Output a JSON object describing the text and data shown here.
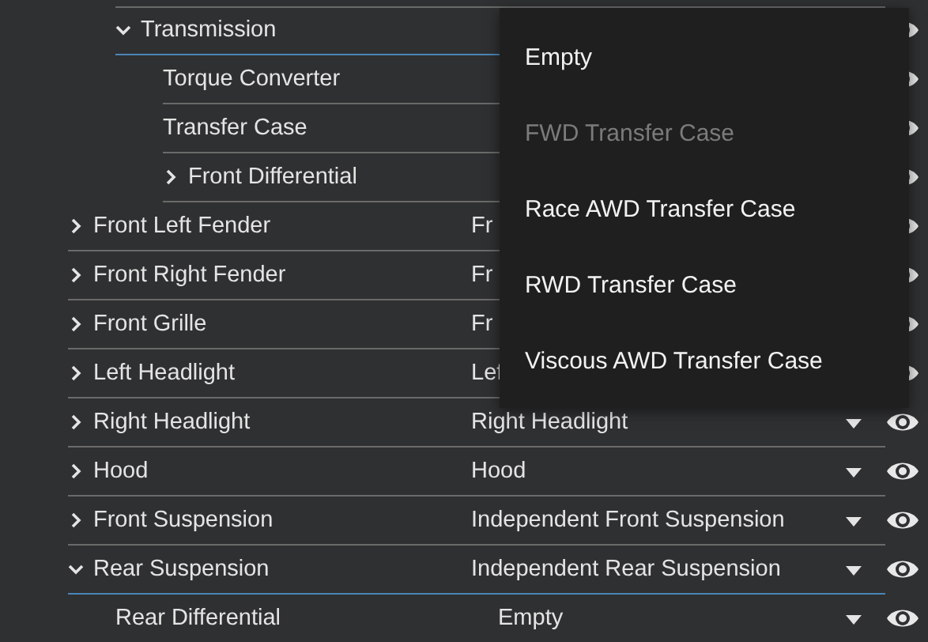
{
  "rows": [
    {
      "children": [
        {
          "label": "Transmission",
          "expanded": true,
          "children": [
            {
              "label": "Torque Converter"
            },
            {
              "label": "Transfer Case"
            },
            {
              "label": "Front Differential",
              "expanded": false
            }
          ]
        }
      ]
    },
    {
      "label": "Front Left Fender",
      "value": "Fr",
      "expanded": false,
      "children": []
    },
    {
      "label": "Front Right Fender",
      "value": "Fr",
      "expanded": false,
      "children": []
    },
    {
      "label": "Front Grille",
      "value": "Fr",
      "expanded": false,
      "children": []
    },
    {
      "label": "Left Headlight",
      "value": "Lef",
      "expanded": false,
      "children": []
    },
    {
      "label": "Right Headlight",
      "value": "Right Headlight",
      "expanded": false,
      "children": []
    },
    {
      "label": "Hood",
      "value": "Hood",
      "expanded": false,
      "children": []
    },
    {
      "label": "Front Suspension",
      "value": "Independent Front Suspension",
      "expanded": false,
      "children": []
    },
    {
      "label": "Rear Suspension",
      "value": "Independent Rear Suspension",
      "expanded": true,
      "children": [
        {
          "label": "Rear Differential",
          "value": "Empty"
        }
      ]
    }
  ],
  "menu": [
    {
      "label": "Empty",
      "disabled": false
    },
    {
      "label": "FWD Transfer Case",
      "disabled": true
    },
    {
      "label": "Race AWD Transfer Case",
      "disabled": false
    },
    {
      "label": "RWD Transfer Case",
      "disabled": false
    },
    {
      "label": "Viscous AWD Transfer Case",
      "disabled": false
    }
  ]
}
